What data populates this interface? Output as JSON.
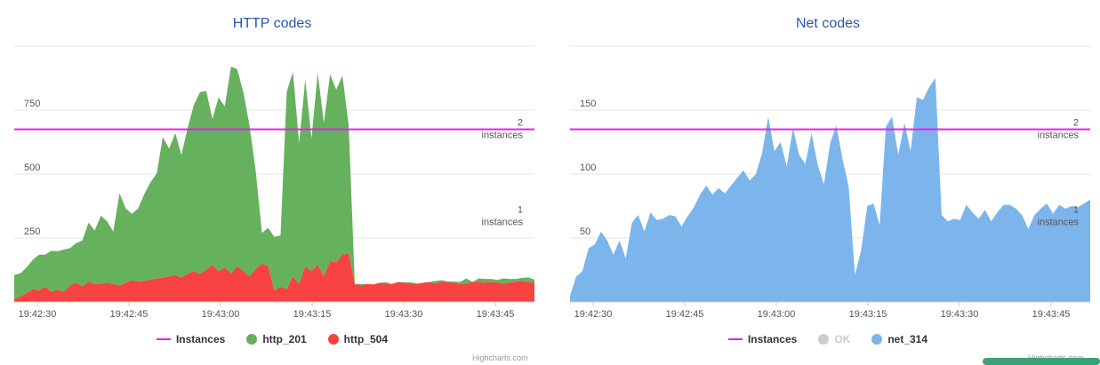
{
  "chart_data": [
    {
      "type": "area",
      "title": "HTTP codes",
      "stacked": true,
      "x_labels": [
        "19:42:30",
        "19:42:45",
        "19:43:00",
        "19:43:15",
        "19:43:30",
        "19:43:45"
      ],
      "ylim": [
        0,
        1000
      ],
      "y_ticks": [
        250,
        500,
        750
      ],
      "grid": true,
      "legend_position": "bottom-center",
      "plot_lines": [
        {
          "value": 675,
          "line1": "2",
          "line2": "instances",
          "color": "#e81ee8",
          "drawn": true
        },
        {
          "value": 335,
          "line1": "1",
          "line2": "instances",
          "color": "#e81ee8",
          "drawn": false
        }
      ],
      "legend": [
        {
          "name": "Instances",
          "symbol": "line",
          "color": "#e81ee8",
          "disabled": false
        },
        {
          "name": "http_201",
          "symbol": "dot",
          "color": "#65b15d",
          "disabled": false
        },
        {
          "name": "http_504",
          "symbol": "dot",
          "color": "#f74242",
          "disabled": false
        }
      ],
      "series": [
        {
          "name": "http_504",
          "color": "#f74242",
          "values": [
            10,
            22,
            35,
            50,
            45,
            60,
            40,
            48,
            40,
            65,
            75,
            60,
            80,
            70,
            72,
            75,
            70,
            65,
            75,
            85,
            80,
            82,
            88,
            92,
            95,
            100,
            105,
            95,
            110,
            120,
            110,
            125,
            145,
            120,
            135,
            110,
            140,
            120,
            100,
            130,
            150,
            140,
            45,
            60,
            50,
            100,
            70,
            140,
            120,
            145,
            100,
            160,
            155,
            185,
            190,
            70,
            65,
            70,
            68,
            75,
            72,
            70,
            78,
            75,
            72,
            70,
            75,
            78,
            72,
            80,
            78,
            75,
            70,
            72,
            78,
            80,
            75,
            78,
            76,
            72,
            75,
            80,
            82,
            78,
            75
          ]
        },
        {
          "name": "http_201",
          "color": "#65b15d",
          "values": [
            95,
            90,
            100,
            115,
            140,
            125,
            160,
            150,
            165,
            145,
            155,
            180,
            230,
            210,
            265,
            240,
            205,
            360,
            290,
            260,
            285,
            340,
            380,
            410,
            550,
            500,
            555,
            480,
            570,
            650,
            710,
            700,
            570,
            680,
            630,
            810,
            770,
            700,
            590,
            380,
            120,
            150,
            210,
            200,
            770,
            800,
            550,
            730,
            520,
            750,
            600,
            730,
            675,
            700,
            500,
            0,
            5,
            0,
            0,
            0,
            5,
            0,
            0,
            2,
            5,
            2,
            0,
            0,
            10,
            5,
            2,
            5,
            8,
            20,
            0,
            12,
            15,
            12,
            10,
            20,
            15,
            10,
            12,
            18,
            12
          ]
        }
      ]
    },
    {
      "type": "area",
      "title": "Net codes",
      "stacked": false,
      "x_labels": [
        "19:42:30",
        "19:42:45",
        "19:43:00",
        "19:43:15",
        "19:43:30",
        "19:43:45"
      ],
      "ylim": [
        0,
        200
      ],
      "y_ticks": [
        50,
        100,
        150
      ],
      "grid": true,
      "legend_position": "bottom-center",
      "plot_lines": [
        {
          "value": 135,
          "line1": "2",
          "line2": "instances",
          "color": "#e81ee8",
          "drawn": true
        },
        {
          "value": 67,
          "line1": "1",
          "line2": "instances",
          "color": "#e81ee8",
          "drawn": false
        }
      ],
      "legend": [
        {
          "name": "Instances",
          "symbol": "line",
          "color": "#e81ee8",
          "disabled": false
        },
        {
          "name": "OK",
          "symbol": "dot",
          "color": "#cccccc",
          "disabled": true
        },
        {
          "name": "net_314",
          "symbol": "dot",
          "color": "#7cb5ec",
          "disabled": false
        }
      ],
      "series": [
        {
          "name": "net_314",
          "color": "#7cb5ec",
          "values": [
            5,
            20,
            24,
            42,
            45,
            55,
            48,
            37,
            48,
            34,
            62,
            68,
            55,
            70,
            64,
            65,
            68,
            67,
            59,
            67,
            74,
            84,
            91,
            84,
            89,
            85,
            91,
            97,
            103,
            95,
            100,
            116,
            145,
            118,
            125,
            106,
            136,
            115,
            108,
            132,
            107,
            92,
            124,
            138,
            112,
            90,
            21,
            40,
            75,
            77,
            60,
            137,
            145,
            115,
            140,
            118,
            160,
            158,
            168,
            175,
            68,
            63,
            65,
            64,
            76,
            70,
            65,
            72,
            63,
            70,
            76,
            76,
            73,
            68,
            57,
            68,
            73,
            77,
            69,
            76,
            73,
            75,
            74,
            77,
            80
          ]
        }
      ]
    }
  ],
  "panels": [
    {
      "title": "HTTP codes",
      "credits": "Highcharts.com"
    },
    {
      "title": "Net codes",
      "credits": "Highcharts.com"
    }
  ]
}
